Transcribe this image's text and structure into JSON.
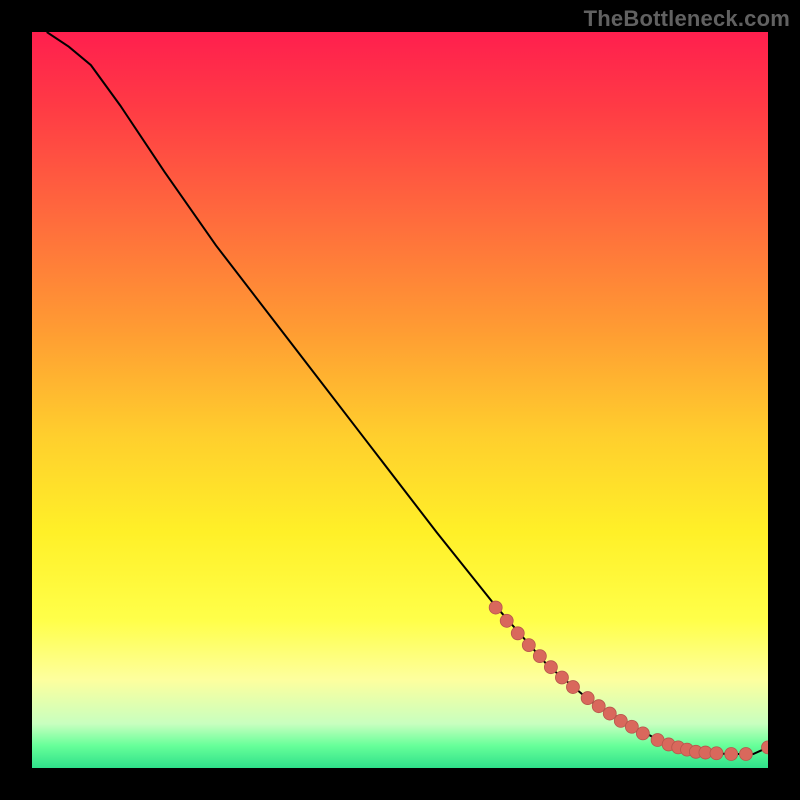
{
  "watermark": "TheBottleneck.com",
  "colors": {
    "curve": "#000000",
    "marker_fill": "#d9685c",
    "marker_stroke": "#b7564c",
    "gradient_stops": [
      {
        "offset": 0.0,
        "color": "#ff1f4e"
      },
      {
        "offset": 0.1,
        "color": "#ff3a45"
      },
      {
        "offset": 0.25,
        "color": "#ff6a3d"
      },
      {
        "offset": 0.4,
        "color": "#ff9a33"
      },
      {
        "offset": 0.55,
        "color": "#ffcf2d"
      },
      {
        "offset": 0.68,
        "color": "#fff028"
      },
      {
        "offset": 0.8,
        "color": "#ffff4a"
      },
      {
        "offset": 0.88,
        "color": "#fdff9e"
      },
      {
        "offset": 0.94,
        "color": "#c8ffbf"
      },
      {
        "offset": 0.97,
        "color": "#66ff99"
      },
      {
        "offset": 1.0,
        "color": "#2fe08a"
      }
    ]
  },
  "chart_data": {
    "type": "line",
    "title": "",
    "xlabel": "",
    "ylabel": "",
    "xlim": [
      0,
      100
    ],
    "ylim": [
      0,
      100
    ],
    "grid": false,
    "legend": false,
    "series": [
      {
        "name": "curve",
        "x": [
          2,
          5,
          8,
          12,
          18,
          25,
          35,
          45,
          55,
          63,
          70,
          76,
          82,
          86,
          89,
          92,
          95,
          98,
          100
        ],
        "y": [
          100,
          98,
          95.5,
          90,
          81,
          71,
          58,
          45,
          32,
          22,
          14,
          9,
          5.5,
          3.3,
          2.4,
          2.0,
          1.9,
          1.9,
          2.8
        ]
      }
    ],
    "markers": {
      "name": "dots",
      "x": [
        63,
        64.5,
        66,
        67.5,
        69,
        70.5,
        72,
        73.5,
        75.5,
        77,
        78.5,
        80,
        81.5,
        83,
        85,
        86.5,
        87.8,
        89,
        90.2,
        91.5,
        93,
        95,
        97,
        100
      ],
      "y": [
        21.8,
        20.0,
        18.3,
        16.7,
        15.2,
        13.7,
        12.3,
        11.0,
        9.5,
        8.4,
        7.4,
        6.4,
        5.6,
        4.7,
        3.8,
        3.2,
        2.8,
        2.5,
        2.2,
        2.1,
        2.0,
        1.9,
        1.9,
        2.8
      ]
    }
  }
}
